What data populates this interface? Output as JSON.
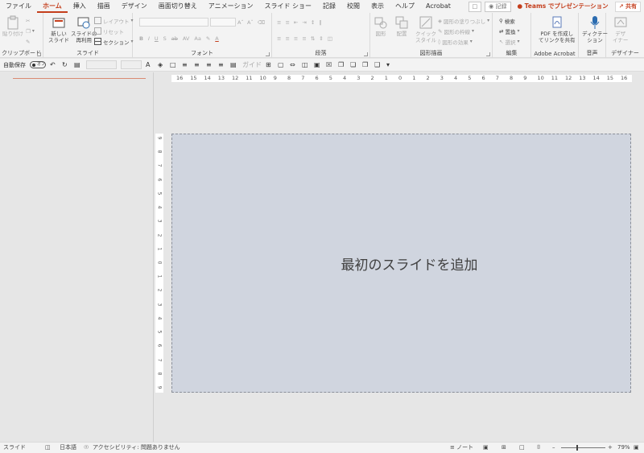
{
  "tabs": [
    "ファイル",
    "ホーム",
    "挿入",
    "描画",
    "デザイン",
    "画面切り替え",
    "アニメーション",
    "スライド ショー",
    "記録",
    "校閲",
    "表示",
    "ヘルプ",
    "Acrobat"
  ],
  "active_tab": "ホーム",
  "header_right": {
    "record": "記録",
    "teams": "Teams でプレゼンテーション",
    "share": "共有"
  },
  "ribbon": {
    "clipboard": {
      "label": "クリップボード",
      "paste": "貼り付け"
    },
    "slides": {
      "label": "スライド",
      "new_slide": "新しい\nスライド",
      "reuse": "スライドの\n再利用",
      "layout": "レイアウト",
      "reset": "リセット",
      "section": "セクション"
    },
    "font": {
      "label": "フォント",
      "aa": "Aa"
    },
    "paragraph": {
      "label": "段落",
      "guide": "ガイド"
    },
    "drawing": {
      "label": "図形描画",
      "shapes": "図形",
      "arrange": "配置",
      "quick_styles": "クイック\nスタイル",
      "fill": "図形の塗りつぶし",
      "outline": "図形の枠線",
      "effects": "図形の効果"
    },
    "editing": {
      "label": "編集",
      "find": "検索",
      "replace": "置換",
      "select": "選択"
    },
    "acrobat": {
      "label": "Adobe Acrobat",
      "create": "PDF を作成し\nてリンクを共有"
    },
    "voice": {
      "label": "音声",
      "dictate": "ディクテー\nション"
    },
    "designer": {
      "label": "デザイナー",
      "design": "デザ\nイナー"
    }
  },
  "qat": {
    "autosave_label": "自動保存",
    "autosave_state": "オフ"
  },
  "ruler_h": [
    "16",
    "15",
    "14",
    "13",
    "12",
    "11",
    "10",
    "9",
    "8",
    "7",
    "6",
    "5",
    "4",
    "3",
    "2",
    "1",
    "0",
    "1",
    "2",
    "3",
    "4",
    "5",
    "6",
    "7",
    "8",
    "9",
    "10",
    "11",
    "12",
    "13",
    "14",
    "15",
    "16"
  ],
  "ruler_v": [
    "9",
    "8",
    "7",
    "6",
    "5",
    "4",
    "3",
    "2",
    "1",
    "0",
    "1",
    "2",
    "3",
    "4",
    "5",
    "6",
    "7",
    "8",
    "9"
  ],
  "slide": {
    "placeholder": "最初のスライドを追加"
  },
  "status": {
    "slide": "スライド",
    "language": "日本語",
    "accessibility": "アクセシビリティ: 問題ありません",
    "notes": "ノート",
    "zoom": "79%"
  },
  "colors": {
    "accent": "#c43e1c",
    "slide_bg": "#d0d5df"
  }
}
